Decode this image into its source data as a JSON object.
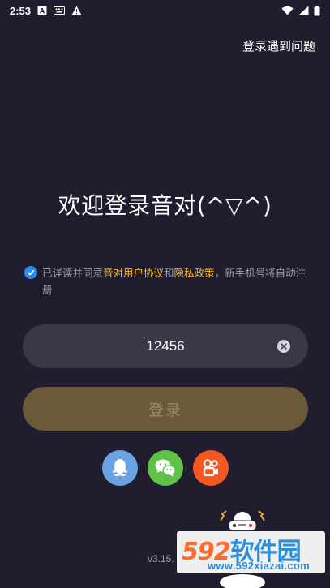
{
  "status_bar": {
    "time": "2:53",
    "icons": [
      "notification-a-icon",
      "keyboard-icon",
      "warning-icon",
      "wifi-icon",
      "signal-icon",
      "battery-icon"
    ]
  },
  "header": {
    "help_link": "登录遇到问题"
  },
  "main": {
    "welcome_title": "欢迎登录音对(^▽^)",
    "agreement": {
      "checked": true,
      "prefix": "已详读并同意",
      "user_agreement": "音对用户协议",
      "and": "和",
      "privacy_policy": "隐私政策",
      "suffix": "，新手机号将自动注册"
    },
    "phone_input": {
      "value": "12456",
      "placeholder": ""
    },
    "login_button": "登录",
    "social_logins": [
      "qq-icon",
      "wechat-icon",
      "kuaishou-icon"
    ]
  },
  "footer": {
    "version": "v3.15."
  },
  "watermark": {
    "brand_number": "592",
    "brand_text": "软件园",
    "url": "www.592xiazai.com"
  },
  "colors": {
    "background": "#1f1d2e",
    "field": "#3a3847",
    "login_button": "#6b5a37",
    "link": "#f2b632",
    "check": "#2d8cf0",
    "qq": "#6aa2e4",
    "wechat": "#5ec14a",
    "kuaishou": "#f4571f"
  }
}
